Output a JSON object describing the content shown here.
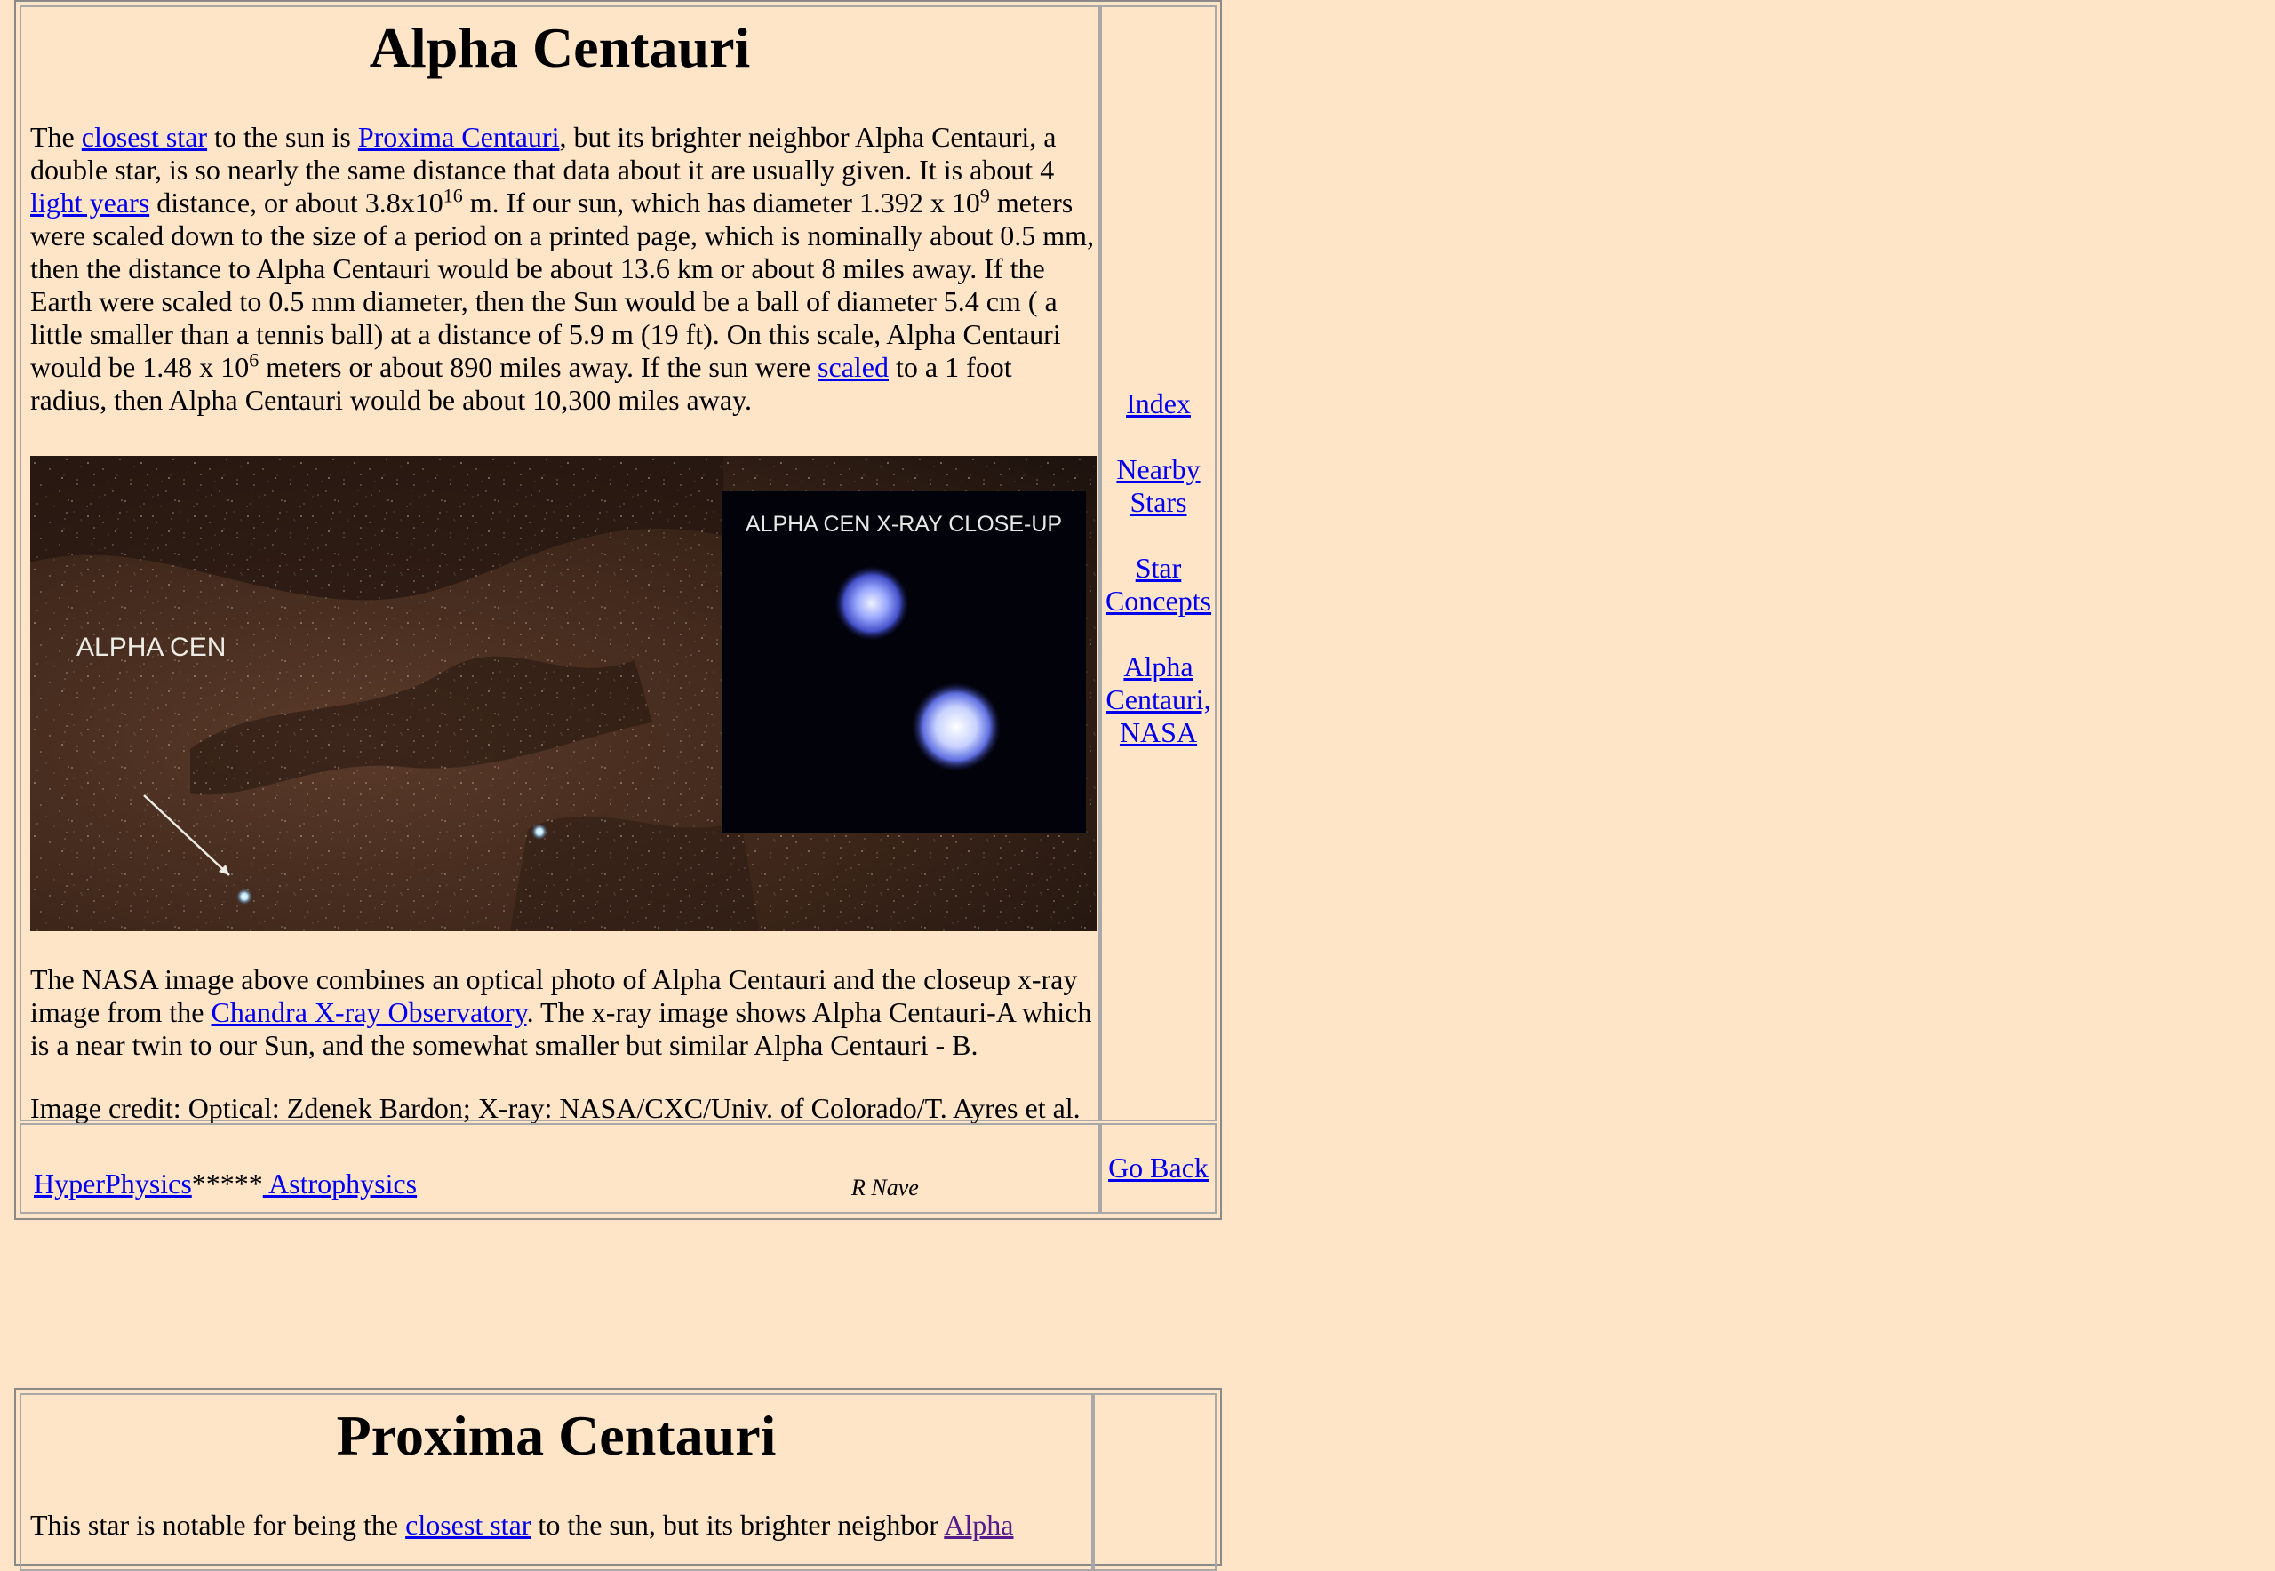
{
  "alpha": {
    "title": "Alpha Centauri",
    "p1": {
      "t1": "The ",
      "link_closest": "closest star",
      "t2": " to the sun is ",
      "link_proxima": "Proxima Centauri",
      "t3": ", but its brighter neighbor Alpha Centauri, a double star, is so nearly the same distance that data about it are usually given. It is about 4 ",
      "link_ly": "light years",
      "t4": " distance, or about 3.8x10",
      "sup1": "16",
      "t5": " m. If our sun, which has diameter 1.392 x 10",
      "sup2": "9",
      "t6": " meters were scaled down to the size of a period on a printed page, which is nominally about 0.5 mm, then the distance to Alpha Centauri would be about 13.6 km or about 8 miles away. If the Earth were scaled to 0.5 mm diameter, then the Sun would be a ball of diameter 5.4 cm ( a little smaller than a tennis ball) at a distance of 5.9 m (19 ft). On this scale, Alpha Centauri would be 1.48 x 10",
      "sup3": "6",
      "t7": " meters or about 890 miles away. If the sun were ",
      "link_scaled": "scaled",
      "t8": " to a 1 foot radius, then Alpha Centauri would be about 10,300 miles away."
    },
    "image": {
      "label_main": "ALPHA CEN",
      "label_inset": "ALPHA CEN X-RAY CLOSE-UP"
    },
    "p2": {
      "t1": "The NASA image above combines an optical photo of Alpha Centauri and the closeup x-ray image from the ",
      "link_chandra": "Chandra X-ray Observatory",
      "t2": ". The x-ray image shows Alpha Centauri-A which is a near twin to our Sun, and the somewhat smaller but similar Alpha Centauri - B."
    },
    "p3": "Image credit: Optical: Zdenek Bardon; X-ray: NASA/CXC/Univ. of Colorado/T. Ayres et al.",
    "side_nav": [
      "Index",
      "Nearby Stars",
      "Star Concepts",
      "Alpha Centauri, NASA"
    ],
    "footer": {
      "link_hyperphysics": "HyperPhysics",
      "stars": "*****",
      "link_astrophysics": " Astrophysics",
      "author": "R Nave",
      "go_back": "Go Back"
    }
  },
  "proxima": {
    "title": "Proxima Centauri",
    "p1": {
      "t1": "This star is notable for being the ",
      "link_closest": "closest star",
      "t2": " to the sun, but its brighter neighbor ",
      "link_alpha": "Alpha"
    }
  },
  "colors": {
    "background": "#FFE5C8",
    "link": "#0000EE",
    "visited_link": "#551A8B",
    "border": "#a8a8a8"
  }
}
